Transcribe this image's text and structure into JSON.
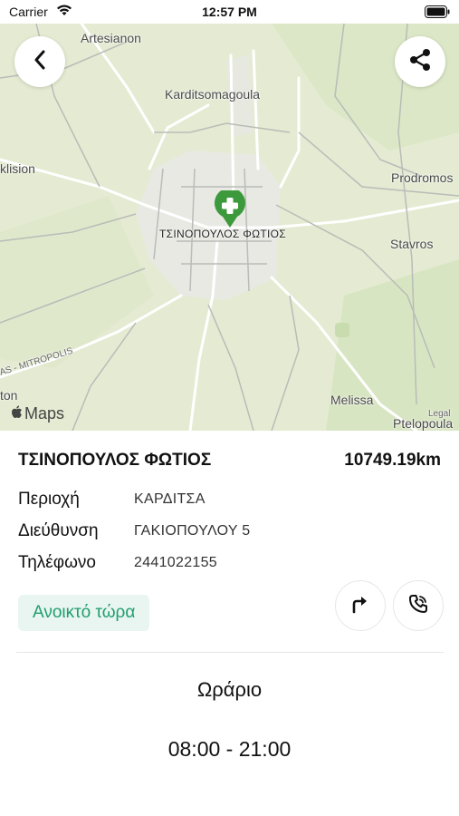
{
  "status_bar": {
    "carrier": "Carrier",
    "time": "12:57 PM"
  },
  "map": {
    "labels": {
      "artesianon": "Artesianon",
      "karditsomagoula": "Karditsomagoula",
      "klision": "klision",
      "prodromos": "Prodromos",
      "stavros": "Stavros",
      "pharmacy": "ΤΣΙΝΟΠΟΥΛΟΣ ΦΩΤΙΟΣ",
      "road": "AS - MITROPOLIS",
      "ton": "ton",
      "melissa": "Melissa",
      "legal": "Legal",
      "ptelopoula": "Ptelopoula"
    },
    "maps_logo": "Maps",
    "pin_icon": "pharmacy-cross-pin",
    "pin_color": "#3d9a3c"
  },
  "pharmacy": {
    "name": "ΤΣΙΝΟΠΟΥΛΟΣ ΦΩΤΙΟΣ",
    "distance": "10749.19km",
    "region_label": "Περιοχή",
    "region_value": "ΚΑΡΔΙΤΣΑ",
    "address_label": "Διεύθυνση",
    "address_value": "ΓΑΚΙΟΠΟΥΛΟΥ 5",
    "phone_label": "Τηλέφωνο",
    "phone_value": "2441022155",
    "status": "Ανοικτό τώρα",
    "status_color": "#1f9e6e"
  },
  "hours": {
    "title": "Ωράριο",
    "value": "08:00 - 21:00"
  },
  "icons": {
    "back": "chevron-left-icon",
    "share": "share-icon",
    "directions": "turn-right-arrow-icon",
    "call": "phone-icon"
  }
}
